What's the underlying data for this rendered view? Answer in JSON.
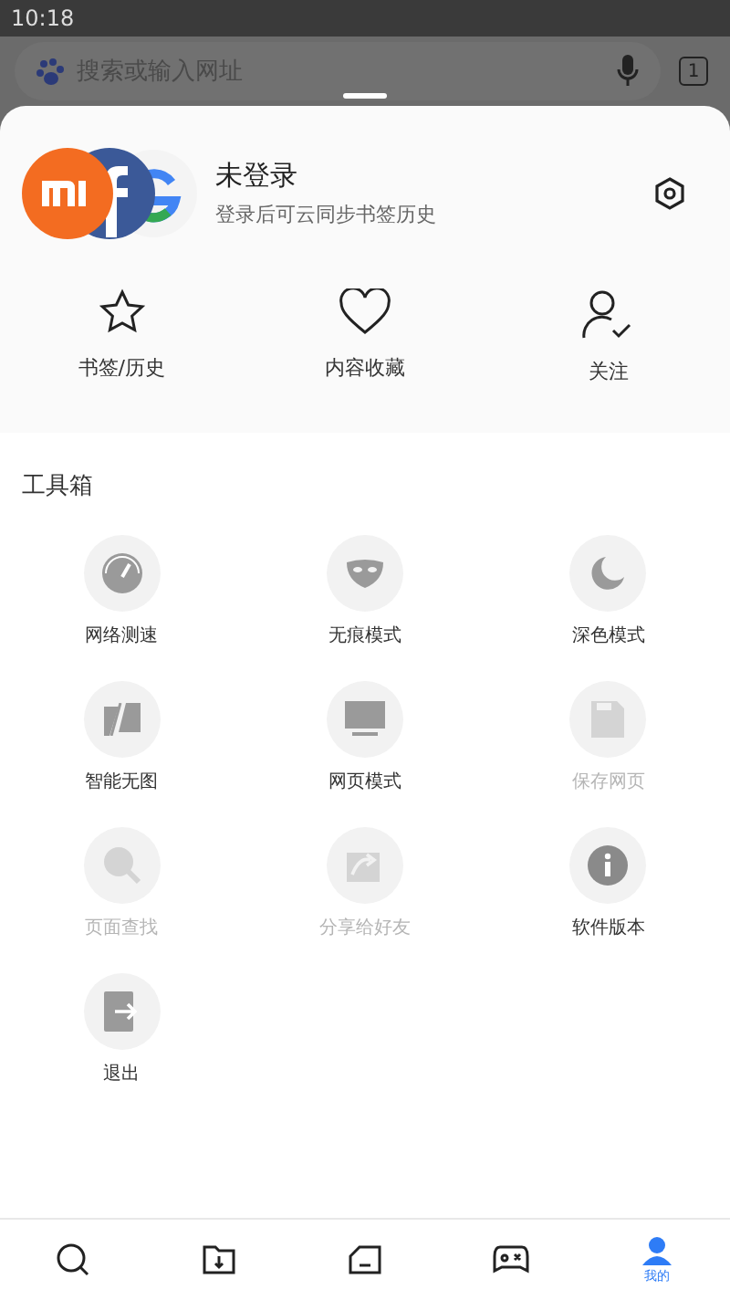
{
  "status_bar": {
    "time": "10:18"
  },
  "browser_bar": {
    "placeholder": "搜索或输入网址",
    "tab_count": "1"
  },
  "profile": {
    "title": "未登录",
    "subtitle": "登录后可云同步书签历史"
  },
  "quick_actions": [
    {
      "kind": "star",
      "label": "书签/历史"
    },
    {
      "kind": "heart",
      "label": "内容收藏"
    },
    {
      "kind": "follow",
      "label": "关注"
    }
  ],
  "toolbox": {
    "title": "工具箱",
    "items": [
      {
        "kind": "speed",
        "label": "网络测速",
        "disabled": false
      },
      {
        "kind": "mask",
        "label": "无痕模式",
        "disabled": false
      },
      {
        "kind": "moon",
        "label": "深色模式",
        "disabled": false
      },
      {
        "kind": "noimage",
        "label": "智能无图",
        "disabled": false
      },
      {
        "kind": "desktop",
        "label": "网页模式",
        "disabled": false
      },
      {
        "kind": "save",
        "label": "保存网页",
        "disabled": true
      },
      {
        "kind": "find",
        "label": "页面查找",
        "disabled": true
      },
      {
        "kind": "share",
        "label": "分享给好友",
        "disabled": true
      },
      {
        "kind": "info",
        "label": "软件版本",
        "disabled": false
      },
      {
        "kind": "exit",
        "label": "退出",
        "disabled": false
      }
    ]
  },
  "bottom_nav": [
    {
      "kind": "search",
      "selected": false
    },
    {
      "kind": "download",
      "selected": false
    },
    {
      "kind": "tabs",
      "selected": false
    },
    {
      "kind": "game",
      "selected": false
    },
    {
      "kind": "me",
      "label": "我的",
      "selected": true
    }
  ]
}
